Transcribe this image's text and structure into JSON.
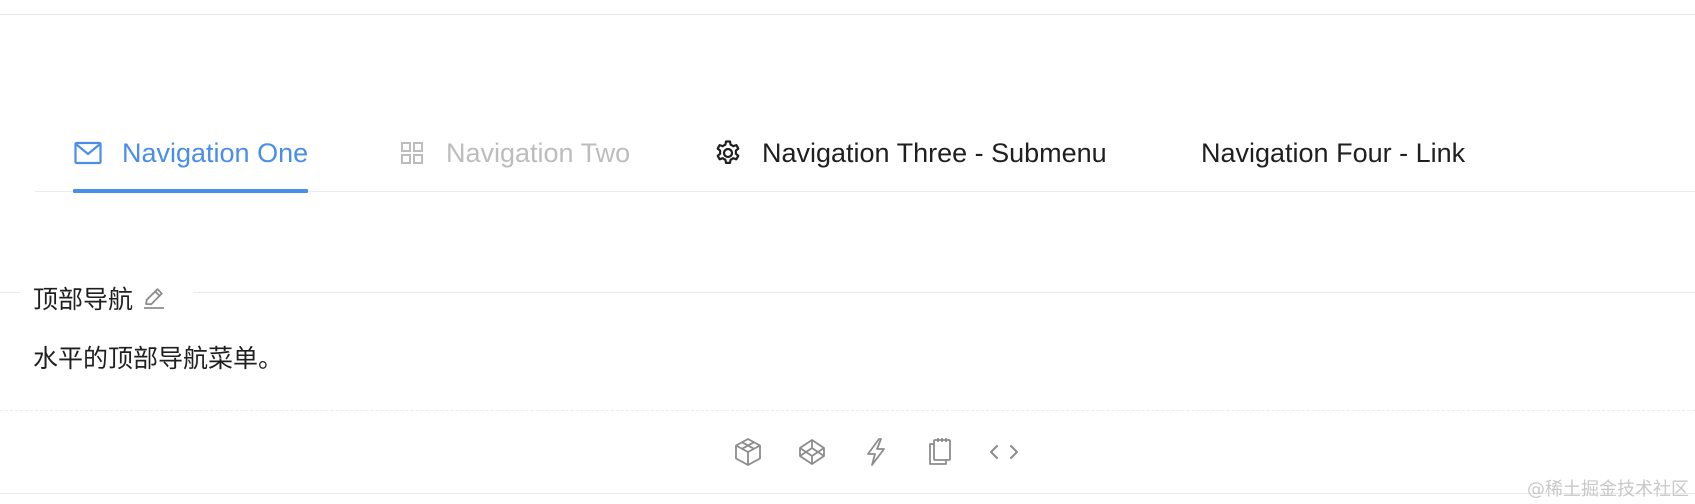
{
  "menu": {
    "items": [
      {
        "label": "Navigation One",
        "icon": "mail-icon",
        "state": "active"
      },
      {
        "label": "Navigation Two",
        "icon": "appstore-icon",
        "state": "disabled"
      },
      {
        "label": "Navigation Three - Submenu",
        "icon": "setting-icon",
        "state": "normal"
      },
      {
        "label": "Navigation Four - Link",
        "icon": "",
        "state": "normal"
      }
    ]
  },
  "demo": {
    "title": "顶部导航",
    "description": "水平的顶部导航菜单。"
  },
  "actions": [
    {
      "icon": "codesandbox-icon"
    },
    {
      "icon": "codepen-icon"
    },
    {
      "icon": "thunderbolt-icon"
    },
    {
      "icon": "snippets-icon"
    },
    {
      "icon": "code-expand-icon"
    }
  ],
  "watermark": "@稀土掘金技术社区",
  "colors": {
    "accent": "#4a8eeb",
    "disabled": "#bdbdbd",
    "icon_muted": "#8c8c8c",
    "text": "#262626"
  }
}
